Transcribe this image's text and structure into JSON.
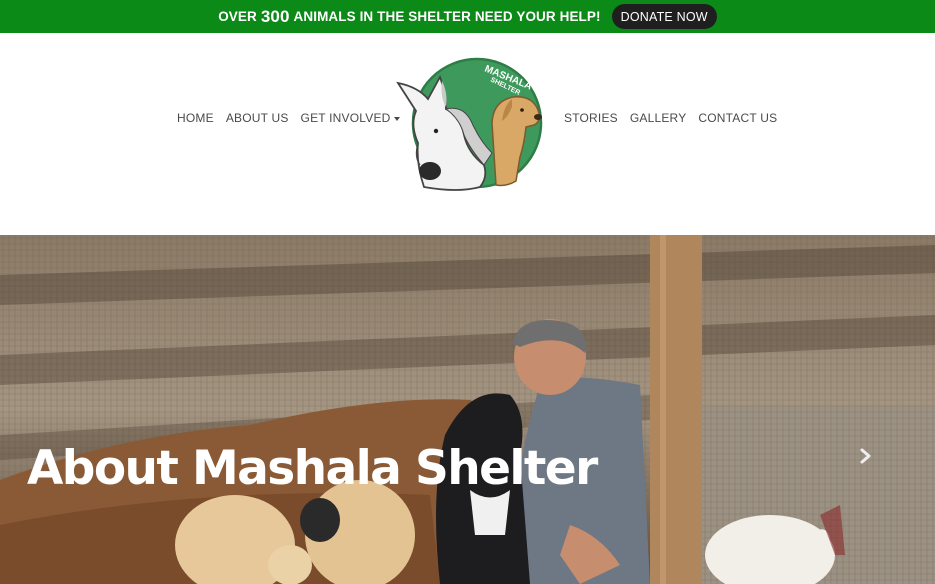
{
  "announcement": {
    "prefix": "OVER",
    "count": "300",
    "suffix": "ANIMALS IN THE SHELTER NEED YOUR HELP!",
    "donate_label": "DONATE NOW",
    "bar_color": "#0c8a17"
  },
  "nav": {
    "left": [
      {
        "label": "HOME"
      },
      {
        "label": "ABOUT US"
      },
      {
        "label": "GET INVOLVED",
        "dropdown": true
      }
    ],
    "right": [
      {
        "label": "STORIES"
      },
      {
        "label": "GALLERY"
      },
      {
        "label": "CONTACT US"
      }
    ]
  },
  "logo": {
    "text_top": "MASHALA",
    "text_bottom": "SHELTER",
    "circle_color": "#3e9a5c"
  },
  "hero": {
    "title": "About Mashala Shelter",
    "next_icon": "chevron-right-icon"
  }
}
